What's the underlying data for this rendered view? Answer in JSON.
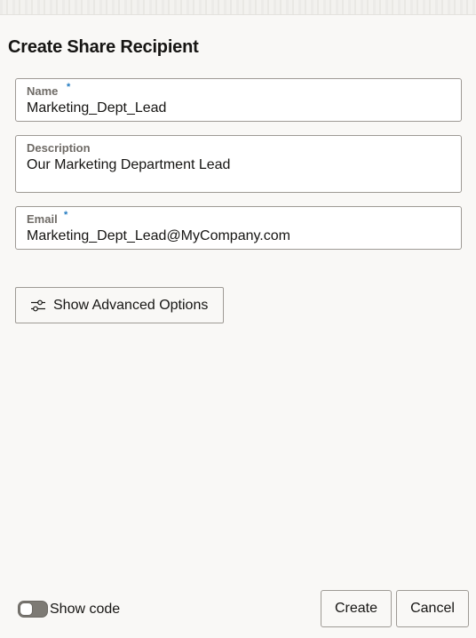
{
  "dialog": {
    "title": "Create Share Recipient"
  },
  "form": {
    "name": {
      "label": "Name",
      "required_mark": "*",
      "value": "Marketing_Dept_Lead"
    },
    "description": {
      "label": "Description",
      "value": "Our Marketing Department Lead"
    },
    "email": {
      "label": "Email",
      "required_mark": "*",
      "value": "Marketing_Dept_Lead@MyCompany.com"
    }
  },
  "advanced": {
    "label": "Show Advanced Options",
    "icon": "sliders-icon"
  },
  "footer": {
    "show_code_label": "Show code",
    "show_code_on": false,
    "create_label": "Create",
    "cancel_label": "Cancel"
  },
  "colors": {
    "required_accent": "#227ac0",
    "background": "#f9f8f6",
    "border": "#9e9a95"
  }
}
